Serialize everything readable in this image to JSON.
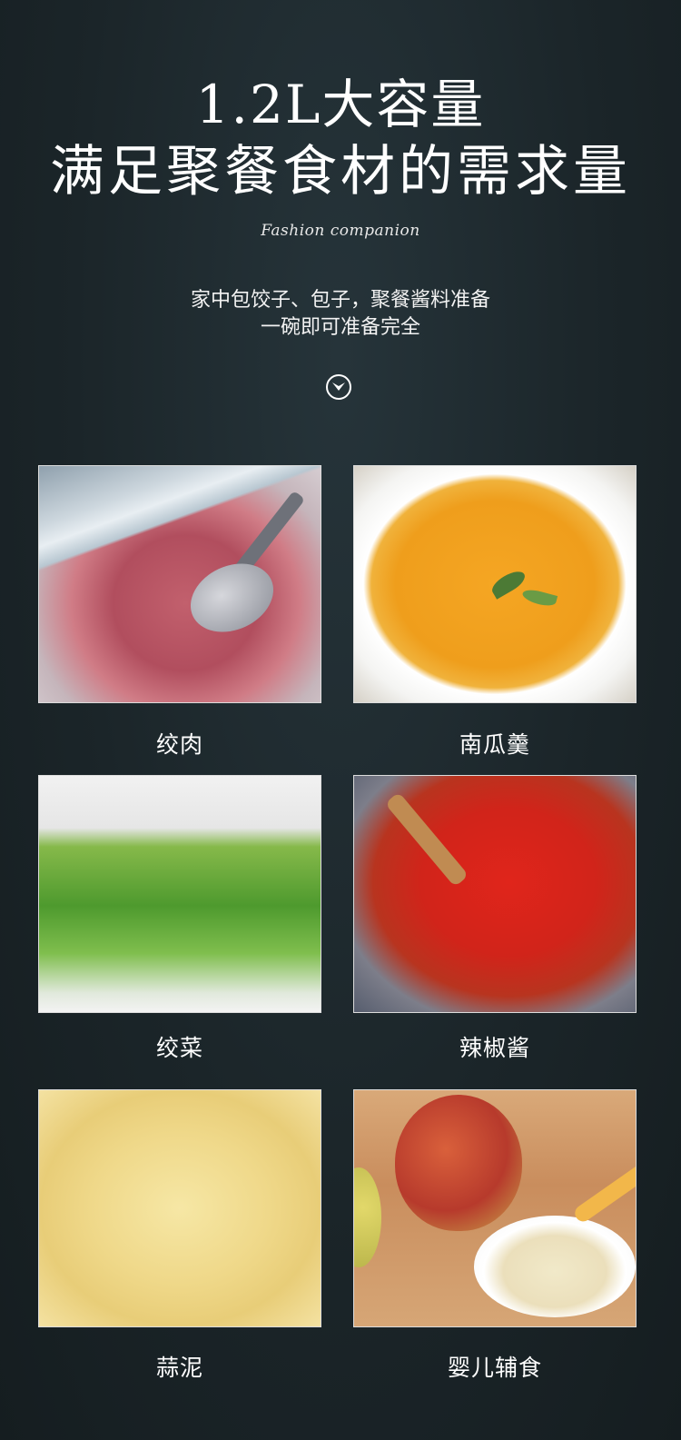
{
  "header": {
    "line1": "1.2L大容量",
    "line2": "满足聚餐食材的需求量",
    "script_text": "Fashion companion",
    "desc_line1": "家中包饺子、包子，聚餐酱料准备",
    "desc_line2": "一碗即可准备完全",
    "arrow_icon": "chevron-down-circle-icon"
  },
  "items": [
    {
      "label": "绞肉"
    },
    {
      "label": "南瓜羹"
    },
    {
      "label": "绞菜"
    },
    {
      "label": "辣椒酱"
    },
    {
      "label": "蒜泥"
    },
    {
      "label": "婴儿辅食"
    }
  ],
  "colors": {
    "background": "#1b2529",
    "text": "#ffffff"
  }
}
